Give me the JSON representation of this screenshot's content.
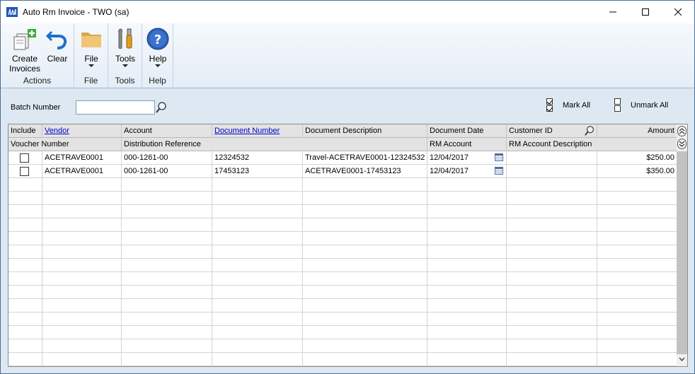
{
  "window": {
    "title": "Auto Rm Invoice  -  TWO (sa)"
  },
  "ribbon": {
    "groups": [
      {
        "label": "Actions",
        "buttons": [
          {
            "label1": "Create",
            "label2": "Invoices"
          },
          {
            "label1": "Clear"
          }
        ]
      },
      {
        "label": "File",
        "buttons": [
          {
            "label1": "File"
          }
        ]
      },
      {
        "label": "Tools",
        "buttons": [
          {
            "label1": "Tools"
          }
        ]
      },
      {
        "label": "Help",
        "buttons": [
          {
            "label1": "Help"
          }
        ]
      }
    ]
  },
  "batch": {
    "label": "Batch Number",
    "value": ""
  },
  "mark_all": {
    "label": "Mark All"
  },
  "unmark_all": {
    "label": "Unmark All"
  },
  "grid": {
    "header1": [
      "Include",
      "Vendor",
      "Account",
      "Document Number",
      "Document Description",
      "Document Date",
      "Customer ID",
      "Amount"
    ],
    "header2": [
      "Voucher Number",
      "Distribution Reference",
      "RM Account",
      "RM Account Description"
    ],
    "rows": [
      {
        "include": false,
        "vendor": "ACETRAVE0001",
        "account": "000-1261-00",
        "doc_number": "12324532",
        "doc_description": "Travel-ACETRAVE0001-12324532",
        "doc_date": "12/04/2017",
        "customer_id": "",
        "amount": "$250.00"
      },
      {
        "include": false,
        "vendor": "ACETRAVE0001",
        "account": "000-1261-00",
        "doc_number": "17453123",
        "doc_description": "ACETRAVE0001-17453123",
        "doc_date": "12/04/2017",
        "customer_id": "",
        "amount": "$350.00"
      }
    ]
  },
  "colors": {
    "accent": "#1f56b3",
    "frame": "#dde8f2",
    "link": "#0000cc"
  }
}
